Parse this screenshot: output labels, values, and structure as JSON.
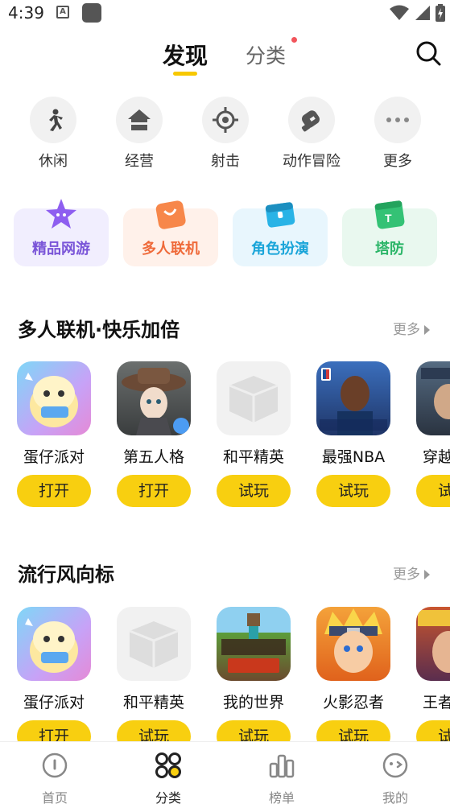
{
  "status": {
    "time": "4:39"
  },
  "header": {
    "tab_discover": "发现",
    "tab_category": "分类"
  },
  "categories": [
    {
      "label": "休闲",
      "icon": "running-person-icon"
    },
    {
      "label": "经营",
      "icon": "house-icon"
    },
    {
      "label": "射击",
      "icon": "crosshair-icon"
    },
    {
      "label": "动作冒险",
      "icon": "boxing-glove-icon"
    },
    {
      "label": "更多",
      "icon": "more-dots-icon"
    }
  ],
  "tags": [
    {
      "label": "精品网游",
      "color": "#7a55d8",
      "bg": "#f1eefe"
    },
    {
      "label": "多人联机",
      "color": "#ef6a3a",
      "bg": "#fff1ea"
    },
    {
      "label": "角色扮演",
      "color": "#1aa5d9",
      "bg": "#e8f6fd"
    },
    {
      "label": "塔防",
      "color": "#2bb568",
      "bg": "#e9f8ef"
    }
  ],
  "section1": {
    "title": "多人联机·快乐加倍",
    "more": "更多",
    "apps": [
      {
        "name": "蛋仔派对",
        "button": "打开"
      },
      {
        "name": "第五人格",
        "button": "打开"
      },
      {
        "name": "和平精英",
        "button": "试玩"
      },
      {
        "name": "最强NBA",
        "button": "试玩"
      },
      {
        "name": "穿越火线",
        "button": "试玩"
      }
    ]
  },
  "section2": {
    "title": "流行风向标",
    "more": "更多",
    "apps": [
      {
        "name": "蛋仔派对",
        "button": "打开"
      },
      {
        "name": "和平精英",
        "button": "试玩"
      },
      {
        "name": "我的世界",
        "button": "试玩"
      },
      {
        "name": "火影忍者",
        "button": "试玩"
      },
      {
        "name": "王者荣耀",
        "button": "试玩"
      }
    ]
  },
  "bottom_nav": [
    {
      "label": "首页",
      "active": false
    },
    {
      "label": "分类",
      "active": true
    },
    {
      "label": "榜单",
      "active": false
    },
    {
      "label": "我的",
      "active": false
    }
  ],
  "colors": {
    "accent": "#f8cf10",
    "dot": "#f2545b"
  }
}
